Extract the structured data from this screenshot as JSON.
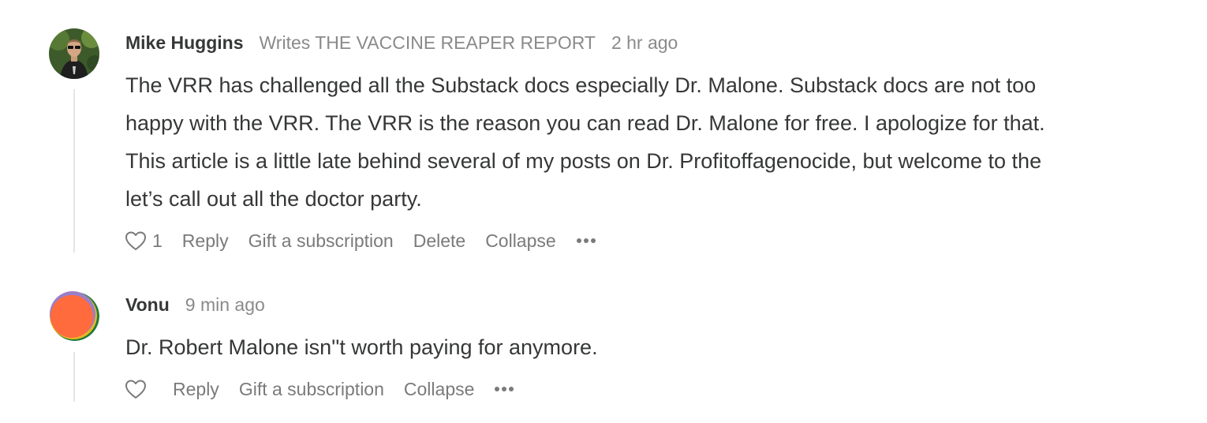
{
  "comments": [
    {
      "author": "Mike Huggins",
      "byline": "Writes THE VACCINE REAPER REPORT",
      "timestamp": "2 hr ago",
      "body_lines": [
        "The VRR has challenged all the Substack docs especially Dr. Malone. Substack docs are not too",
        "happy with the VRR. The VRR is the reason you can read Dr. Malone for free. I apologize for that.",
        "This article is a little late behind several of my posts on Dr. Profitoffagenocide, but welcome to the",
        "let’s call out all the doctor party."
      ],
      "like_count": "1",
      "actions": {
        "reply": "Reply",
        "gift": "Gift a subscription",
        "delete": "Delete",
        "collapse": "Collapse"
      },
      "avatar_icon": "user-photo-avatar"
    },
    {
      "author": "Vonu",
      "timestamp": "9 min ago",
      "body_lines": [
        "Dr. Robert Malone isn''t worth paying for anymore."
      ],
      "actions": {
        "reply": "Reply",
        "gift": "Gift a subscription",
        "collapse": "Collapse"
      },
      "avatar_icon": "colorful-circle-avatar"
    }
  ],
  "colors": {
    "text": "#363737",
    "muted": "#8a8a8a",
    "thread_line": "#e6e6e6"
  },
  "icons": {
    "like": "heart-icon",
    "more": "more-dots-icon"
  }
}
